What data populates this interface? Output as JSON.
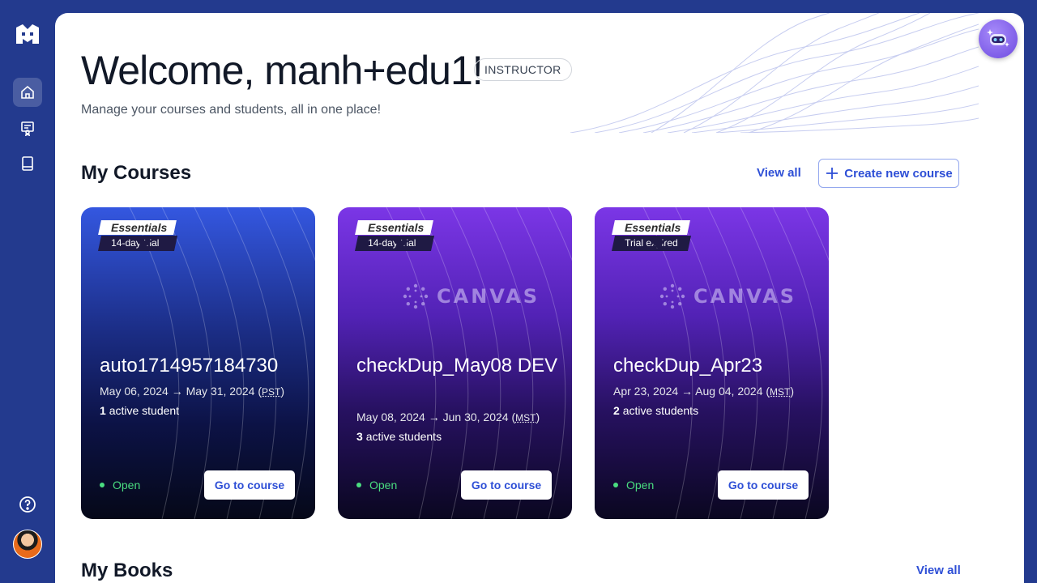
{
  "header": {
    "welcome": "Welcome, manh+edu1!",
    "role_badge": "INSTRUCTOR",
    "subtitle": "Manage your courses and students, all in one place!"
  },
  "courses_section": {
    "title": "My Courses",
    "view_all": "View all",
    "create_label": "Create new course"
  },
  "courses": [
    {
      "plan": "Essentials",
      "plan_status": "14-day trial",
      "name": "auto1714957184730",
      "dates": "May 06, 2024 → May 31, 2024",
      "timezone": "PST",
      "student_count": "1",
      "student_label": "active student",
      "status": "Open",
      "button": "Go to course"
    },
    {
      "plan": "Essentials",
      "plan_status": "14-day trial",
      "logo": "CANVAS",
      "name": "checkDup_May08 DEV",
      "dates": "May 08, 2024 → Jun 30, 2024",
      "timezone": "MST",
      "student_count": "3",
      "student_label": "active students",
      "status": "Open",
      "button": "Go to course"
    },
    {
      "plan": "Essentials",
      "plan_status": "Trial expired",
      "logo": "CANVAS",
      "name": "checkDup_Apr23",
      "dates": "Apr 23, 2024 → Aug 04, 2024",
      "timezone": "MST",
      "student_count": "2",
      "student_label": "active students",
      "status": "Open",
      "button": "Go to course"
    }
  ],
  "books_section": {
    "title": "My Books",
    "view_all": "View all"
  },
  "colors": {
    "sidebar_bg": "#233a8e",
    "accent": "#2e4fd6",
    "status_open": "#4ade80"
  },
  "icons": [
    "logo-icon",
    "home-icon",
    "certificate-icon",
    "book-icon",
    "help-icon",
    "ai-assistant-icon",
    "plus-icon",
    "canvas-icon"
  ]
}
